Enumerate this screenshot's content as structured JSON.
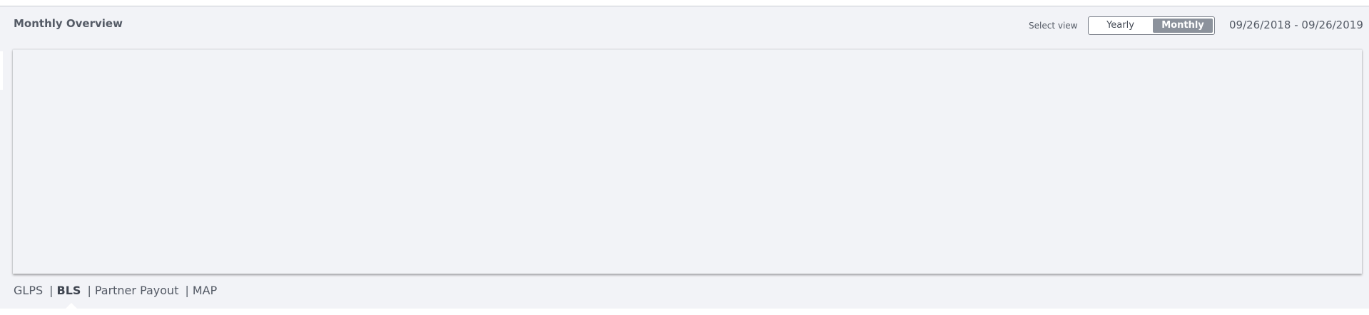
{
  "header": {
    "title": "Monthly Overview",
    "select_view_label": "Select view",
    "view_options": [
      "Yearly",
      "Monthly"
    ],
    "selected_view": "Monthly",
    "date_range": "09/26/2018 - 09/26/2019"
  },
  "tabs": [
    {
      "label": "GLPS",
      "active": false
    },
    {
      "label": "BLS",
      "active": true
    },
    {
      "label": "Partner Payout",
      "active": false
    },
    {
      "label": "MAP",
      "active": false
    }
  ],
  "colors": {
    "panel_background": "#f2f3f7",
    "toggle_active": "#8c929c",
    "text": "#555b66"
  }
}
